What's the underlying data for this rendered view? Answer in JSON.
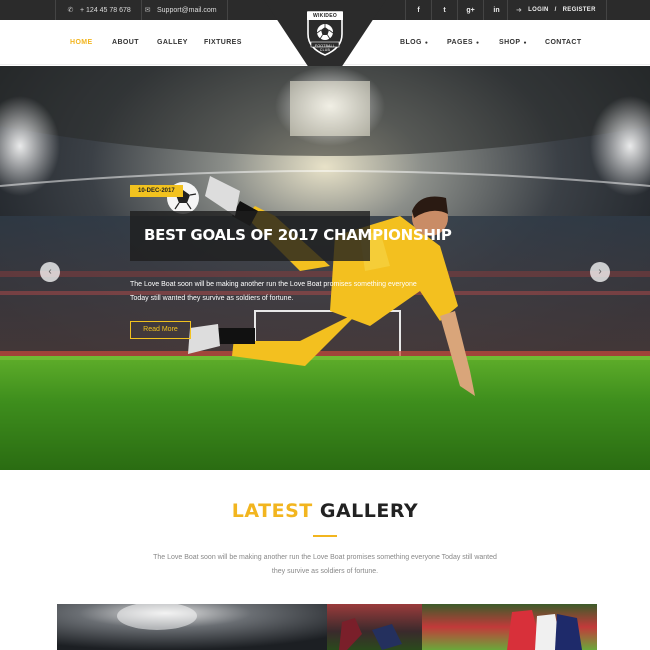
{
  "topbar": {
    "phone": "+ 124 45 78 678",
    "email": "Support@mail.com",
    "social": [
      {
        "icon": "facebook-icon",
        "label": "f"
      },
      {
        "icon": "twitter-icon",
        "label": "t"
      },
      {
        "icon": "google-plus-icon",
        "label": "g+"
      },
      {
        "icon": "linkedin-icon",
        "label": "in"
      }
    ],
    "login_label": "LOGIN",
    "separator": "/",
    "register_label": "REGISTER"
  },
  "logo": {
    "name": "WIKIDEO",
    "tagline": "FOOTBALL CLUB"
  },
  "nav": {
    "left": [
      {
        "label": "HOME",
        "active": true
      },
      {
        "label": "ABOUT"
      },
      {
        "label": "GALLEY"
      },
      {
        "label": "FIXTURES"
      }
    ],
    "right": [
      {
        "label": "BLOG",
        "has_dropdown": true
      },
      {
        "label": "PAGES",
        "has_dropdown": true
      },
      {
        "label": "SHOP",
        "has_dropdown": true
      },
      {
        "label": "CONTACT"
      }
    ],
    "dropdown_glyph": "●"
  },
  "hero": {
    "date": "10-DEC-2017",
    "title": "BEST GOALS OF 2017 CHAMPIONSHIP",
    "description": "The Love Boat soon will be making another run the Love Boat promises something everyone Today still wanted they survive as soldiers of fortune.",
    "read_more": "Read More",
    "prev_glyph": "‹",
    "next_glyph": "›"
  },
  "gallery": {
    "title_highlight": "LATEST",
    "title_rest": "GALLERY",
    "description": "The Love Boat soon will be making another run the Love Boat promises something everyone Today still wanted they survive as soldiers of fortune."
  },
  "colors": {
    "accent": "#f2b51f",
    "topbar_bg": "#2b2b2b",
    "jersey": "#f3c01f",
    "pitch": "#3c8c1c"
  }
}
